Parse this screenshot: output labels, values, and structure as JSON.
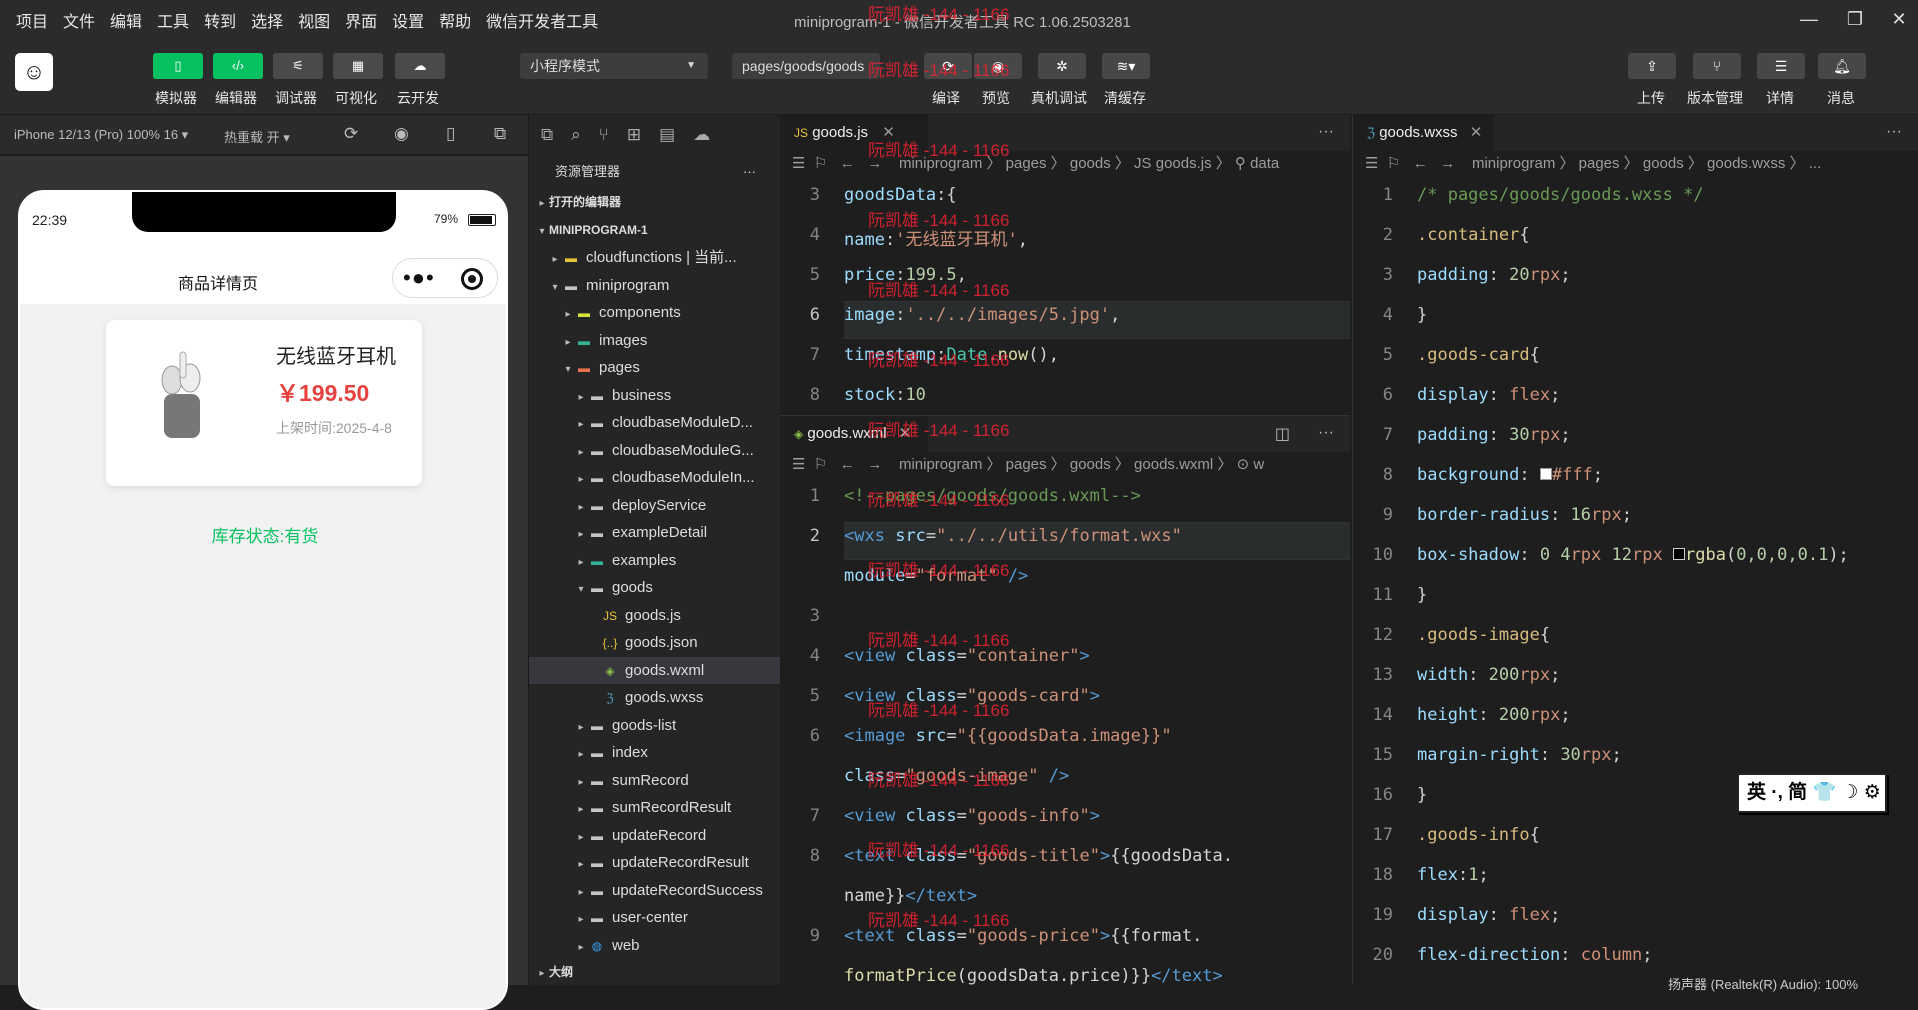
{
  "menubar": {
    "items": [
      "项目",
      "文件",
      "编辑",
      "工具",
      "转到",
      "选择",
      "视图",
      "界面",
      "设置",
      "帮助",
      "微信开发者工具"
    ],
    "title": "miniprogram-1 - 微信开发者工具 RC 1.06.2503281"
  },
  "toolbar": {
    "left_buttons": [
      {
        "icon": "phone-icon",
        "label": "模拟器"
      },
      {
        "icon": "code-icon",
        "label": "编辑器"
      },
      {
        "icon": "sliders-icon",
        "label": "调试器"
      },
      {
        "icon": "layout-icon",
        "label": "可视化"
      },
      {
        "icon": "cloud-icon",
        "label": "云开发"
      }
    ],
    "mode_select": "小程序模式",
    "page_select": "pages/goods/goods",
    "mid_buttons": [
      {
        "icon": "refresh-icon",
        "label": "编译"
      },
      {
        "icon": "eye-icon",
        "label": "预览"
      },
      {
        "icon": "bug-icon",
        "label": "真机调试"
      },
      {
        "icon": "layers-icon",
        "label": "清缓存"
      }
    ],
    "right_buttons": [
      {
        "icon": "upload-icon",
        "label": "上传"
      },
      {
        "icon": "branch-icon",
        "label": "版本管理"
      },
      {
        "icon": "list-icon",
        "label": "详情"
      },
      {
        "icon": "bell-icon",
        "label": "消息"
      }
    ]
  },
  "simbar": {
    "device": "iPhone 12/13 (Pro) 100% 16 ▾",
    "hotreload": "热重载 开 ▾"
  },
  "phone": {
    "time": "22:39",
    "battery": "79%",
    "nav_title": "商品详情页",
    "goods_title": "无线蓝牙耳机",
    "goods_price": "￥199.50",
    "goods_time": "上架时间:2025-4-8",
    "stock": "库存状态:有货"
  },
  "explorer": {
    "title": "资源管理器",
    "rows": [
      {
        "label": "打开的编辑器",
        "indent": 0,
        "arrow": "▸",
        "type": "section"
      },
      {
        "label": "MINIPROGRAM-1",
        "indent": 0,
        "arrow": "▾",
        "type": "section"
      },
      {
        "label": "cloudfunctions | 当前...",
        "indent": 1,
        "arrow": "▸",
        "type": "folder-cloud"
      },
      {
        "label": "miniprogram",
        "indent": 1,
        "arrow": "▾",
        "type": "folder"
      },
      {
        "label": "components",
        "indent": 2,
        "arrow": "▸",
        "type": "folder-comp"
      },
      {
        "label": "images",
        "indent": 2,
        "arrow": "▸",
        "type": "folder-img"
      },
      {
        "label": "pages",
        "indent": 2,
        "arrow": "▾",
        "type": "folder-pages"
      },
      {
        "label": "business",
        "indent": 3,
        "arrow": "▸",
        "type": "folder"
      },
      {
        "label": "cloudbaseModuleD...",
        "indent": 3,
        "arrow": "▸",
        "type": "folder"
      },
      {
        "label": "cloudbaseModuleG...",
        "indent": 3,
        "arrow": "▸",
        "type": "folder"
      },
      {
        "label": "cloudbaseModuleIn...",
        "indent": 3,
        "arrow": "▸",
        "type": "folder"
      },
      {
        "label": "deployService",
        "indent": 3,
        "arrow": "▸",
        "type": "folder"
      },
      {
        "label": "exampleDetail",
        "indent": 3,
        "arrow": "▸",
        "type": "folder"
      },
      {
        "label": "examples",
        "indent": 3,
        "arrow": "▸",
        "type": "folder-img"
      },
      {
        "label": "goods",
        "indent": 3,
        "arrow": "▾",
        "type": "folder"
      },
      {
        "label": "goods.js",
        "indent": 4,
        "arrow": "",
        "type": "js"
      },
      {
        "label": "goods.json",
        "indent": 4,
        "arrow": "",
        "type": "json"
      },
      {
        "label": "goods.wxml",
        "indent": 4,
        "arrow": "",
        "type": "wxml",
        "active": true
      },
      {
        "label": "goods.wxss",
        "indent": 4,
        "arrow": "",
        "type": "wxss"
      },
      {
        "label": "goods-list",
        "indent": 3,
        "arrow": "▸",
        "type": "folder"
      },
      {
        "label": "index",
        "indent": 3,
        "arrow": "▸",
        "type": "folder"
      },
      {
        "label": "sumRecord",
        "indent": 3,
        "arrow": "▸",
        "type": "folder"
      },
      {
        "label": "sumRecordResult",
        "indent": 3,
        "arrow": "▸",
        "type": "folder"
      },
      {
        "label": "updateRecord",
        "indent": 3,
        "arrow": "▸",
        "type": "folder"
      },
      {
        "label": "updateRecordResult",
        "indent": 3,
        "arrow": "▸",
        "type": "folder"
      },
      {
        "label": "updateRecordSuccess",
        "indent": 3,
        "arrow": "▸",
        "type": "folder"
      },
      {
        "label": "user-center",
        "indent": 3,
        "arrow": "▸",
        "type": "folder"
      },
      {
        "label": "web",
        "indent": 3,
        "arrow": "▸",
        "type": "folder-web"
      },
      {
        "label": "大纲",
        "indent": 0,
        "arrow": "▸",
        "type": "section"
      }
    ]
  },
  "editor_js": {
    "tab": "goods.js",
    "crumbs": "miniprogram 〉 pages 〉 goods 〉 JS goods.js 〉 ⚲ data",
    "lines": [
      {
        "n": "3",
        "h": "    <span class='prop'>goodsData</span>:{"
      },
      {
        "n": "4",
        "h": "      <span class='prop'>name</span>:<span class='str'>'无线蓝牙耳机'</span>,"
      },
      {
        "n": "5",
        "h": "      <span class='prop'>price</span>:<span class='num'>199.5</span>,"
      },
      {
        "n": "6",
        "h": "      <span class='prop'>image</span>:<span class='str'>'../../images/5.jpg'</span>,"
      },
      {
        "n": "7",
        "h": "      <span class='prop'>timestamp</span>:<span class='cls'>Date</span>.<span class='fn'>now</span>(),"
      },
      {
        "n": "8",
        "h": "      <span class='prop'>stock</span>:<span class='num'>10</span>"
      }
    ]
  },
  "editor_wxml": {
    "tab": "goods.wxml",
    "crumbs": "miniprogram 〉 pages 〉 goods 〉 goods.wxml 〉 ⊙ w",
    "lines": [
      {
        "n": "1",
        "h": "<span class='cm'>&lt;!--pages/goods/goods.wxml--&gt;</span>"
      },
      {
        "n": "2",
        "h": "<span class='tag'>&lt;wxs</span> <span class='attr'>src</span>=<span class='str'>\"../../utils/format.wxs\"</span>"
      },
      {
        "n": "",
        "h": "<span class='attr'>module</span>=<span class='str'>\"format\"</span> <span class='tag'>/&gt;</span>"
      },
      {
        "n": "3",
        "h": ""
      },
      {
        "n": "4",
        "h": "<span class='tag'>&lt;view</span> <span class='attr'>class</span>=<span class='str'>\"container\"</span><span class='tag'>&gt;</span>"
      },
      {
        "n": "5",
        "h": "  <span class='tag'>&lt;view</span> <span class='attr'>class</span>=<span class='str'>\"goods-card\"</span><span class='tag'>&gt;</span>"
      },
      {
        "n": "6",
        "h": "    <span class='tag'>&lt;image</span> <span class='attr'>src</span>=<span class='str'>\"{{goodsData.image}}\"</span>"
      },
      {
        "n": "",
        "h": "    <span class='attr'>class</span>=<span class='str'>\"goods-image\"</span> <span class='tag'>/&gt;</span>"
      },
      {
        "n": "7",
        "h": "    <span class='tag'>&lt;view</span> <span class='attr'>class</span>=<span class='str'>\"goods-info\"</span><span class='tag'>&gt;</span>"
      },
      {
        "n": "8",
        "h": "      <span class='tag'>&lt;text</span> <span class='attr'>class</span>=<span class='str'>\"goods-title\"</span><span class='tag'>&gt;</span>{{goodsData."
      },
      {
        "n": "",
        "h": "      name}}<span class='tag'>&lt;/text&gt;</span>"
      },
      {
        "n": "9",
        "h": "      <span class='tag'>&lt;text</span> <span class='attr'>class</span>=<span class='str'>\"goods-price\"</span><span class='tag'>&gt;</span>{{format."
      },
      {
        "n": "",
        "h": "      <span class='fn'>formatPrice</span>(goodsData.price)}}<span class='tag'>&lt;/text&gt;</span>"
      }
    ]
  },
  "editor_wxss": {
    "tab": "goods.wxss",
    "crumbs": "miniprogram 〉 pages 〉 goods 〉 goods.wxss 〉 ...",
    "lines": [
      {
        "n": "1",
        "h": "<span class='cm'>/* pages/goods/goods.wxss */</span>"
      },
      {
        "n": "2",
        "h": "<span class='sel2'>.container</span>{"
      },
      {
        "n": "3",
        "h": "  <span class='css-prop'>padding</span>: <span class='css-num'>20</span><span class='val'>rpx</span>;"
      },
      {
        "n": "4",
        "h": "}"
      },
      {
        "n": "5",
        "h": "<span class='sel2'>.goods-card</span>{"
      },
      {
        "n": "6",
        "h": "  <span class='css-prop'>display</span>: <span class='val'>flex</span>;"
      },
      {
        "n": "7",
        "h": "  <span class='css-prop'>padding</span>: <span class='css-num'>30</span><span class='val'>rpx</span>;"
      },
      {
        "n": "8",
        "h": "  <span class='css-prop'>background</span>: <span style='display:inline-block;width:12px;height:12px;background:#fff;border:1px solid #999'></span><span class='val'>#fff</span>;"
      },
      {
        "n": "9",
        "h": "  <span class='css-prop'>border-radius</span>: <span class='css-num'>16</span><span class='val'>rpx</span>;"
      },
      {
        "n": "10",
        "h": "  <span class='css-prop'>box-shadow</span>: <span class='css-num'>0 4</span><span class='val'>rpx</span> <span class='css-num'>12</span><span class='val'>rpx</span> <span style='display:inline-block;width:12px;height:12px;background:#000;border:1px solid #ccc'></span><span class='fn'>rgba</span>(<span class='css-num'>0,0,0,0.1</span>);"
      },
      {
        "n": "11",
        "h": "}"
      },
      {
        "n": "12",
        "h": "<span class='sel2'>.goods-image</span>{"
      },
      {
        "n": "13",
        "h": "  <span class='css-prop'>width</span>: <span class='css-num'>200</span><span class='val'>rpx</span>;"
      },
      {
        "n": "14",
        "h": "  <span class='css-prop'>height</span>: <span class='css-num'>200</span><span class='val'>rpx</span>;"
      },
      {
        "n": "15",
        "h": "  <span class='css-prop'>margin-right</span>: <span class='css-num'>30</span><span class='val'>rpx</span>;"
      },
      {
        "n": "16",
        "h": "}"
      },
      {
        "n": "17",
        "h": "<span class='sel2'>.goods-info</span>{"
      },
      {
        "n": "18",
        "h": "  <span class='css-prop'>flex</span>:<span class='css-num'>1</span>;"
      },
      {
        "n": "19",
        "h": "  <span class='css-prop'>display</span>: <span class='val'>flex</span>;"
      },
      {
        "n": "20",
        "h": "  <span class='css-prop'>flex-direction</span>: <span class='val'>column</span>;"
      }
    ]
  },
  "watermark": "阮凯雄 -144 - 1166",
  "ime": "英 ·, 简 👕 ☽ ⚙",
  "taskbar_hint": "扬声器 (Realtek(R) Audio): 100%"
}
